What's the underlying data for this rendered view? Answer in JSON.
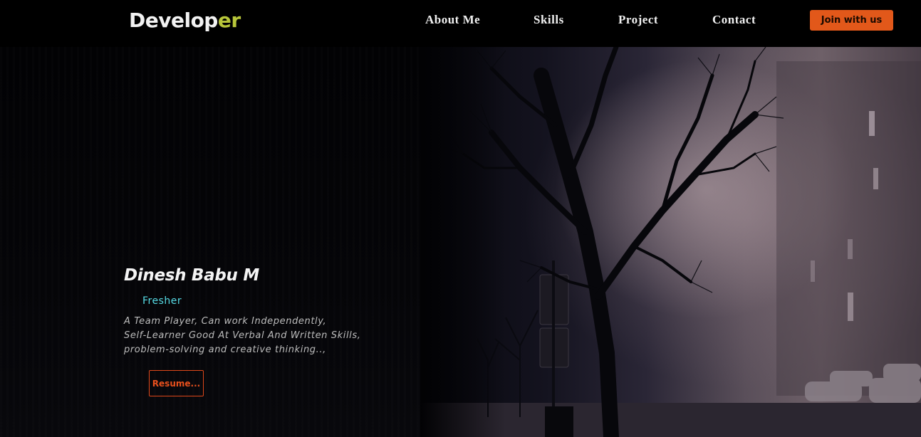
{
  "brand": {
    "name_main": "Develop",
    "name_accent": "er",
    "accent_color": "#b8c63a"
  },
  "nav": {
    "items": [
      {
        "label": "About Me"
      },
      {
        "label": "Skills"
      },
      {
        "label": "Project"
      },
      {
        "label": "Contact"
      }
    ],
    "cta_label": "Join with us",
    "cta_color": "#e2581a"
  },
  "hero": {
    "name": "Dinesh Babu M",
    "role": "Fresher",
    "role_color": "#57dce6",
    "description": [
      "A Team Player, Can work Independently,",
      "Self-Learner Good At Verbal And Written Skills,",
      "problem-solving and creative thinking..,"
    ],
    "resume_label": "Resume...",
    "resume_color": "#e0481a",
    "background_image": "night-tree-fog-photo"
  }
}
